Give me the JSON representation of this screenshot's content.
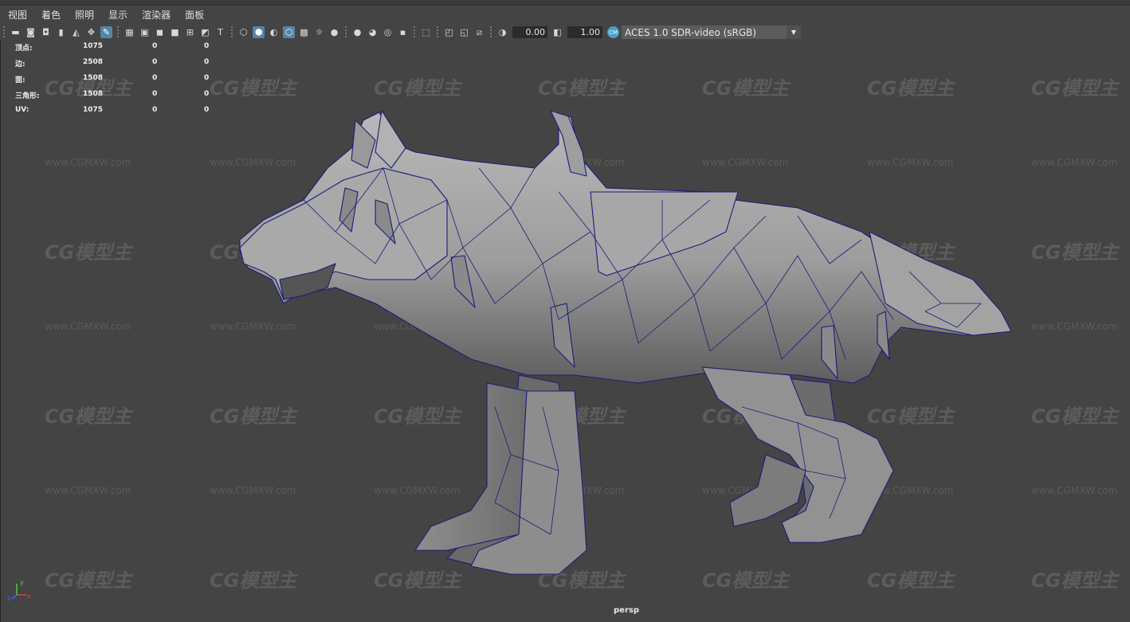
{
  "menu": [
    "视图",
    "着色",
    "照明",
    "显示",
    "渲染器",
    "面板"
  ],
  "toolbar": {
    "exposure_value": "0.00",
    "gamma_value": "1.00",
    "color_mgmt_badge": "CM",
    "color_space": "ACES 1.0 SDR-video (sRGB)"
  },
  "hud": {
    "rows": [
      {
        "label": "顶点:",
        "v1": "1075",
        "v2": "0",
        "v3": "0"
      },
      {
        "label": "边:",
        "v1": "2508",
        "v2": "0",
        "v3": "0"
      },
      {
        "label": "面:",
        "v1": "1508",
        "v2": "0",
        "v3": "0"
      },
      {
        "label": "三角形:",
        "v1": "1508",
        "v2": "0",
        "v3": "0"
      },
      {
        "label": "UV:",
        "v1": "1075",
        "v2": "0",
        "v3": "0"
      }
    ]
  },
  "watermark": {
    "logo": "CG模型主",
    "url": "www.CGMXW.com"
  },
  "axis": {
    "x": "x",
    "y": "y",
    "z": "z"
  },
  "camera_label": "persp",
  "icons": [
    "camera-icon",
    "select-camera-icon",
    "camera-attr-icon",
    "bookmark-icon",
    "image-plane-icon",
    "2d-pan-icon",
    "grease-pencil-icon",
    "grid-icon",
    "film-gate-icon",
    "resolution-gate-icon",
    "gate-mask-icon",
    "field-chart-icon",
    "safe-action-icon",
    "safe-title-icon",
    "wireframe-icon",
    "smooth-shade-icon",
    "default-material-icon",
    "wireframe-on-shaded-icon",
    "textured-icon",
    "lights-icon",
    "shadows-icon",
    "screen-space-ao-icon",
    "motion-blur-icon",
    "anti-aliasing-icon",
    "depth-of-field-icon",
    "isolate-select-icon",
    "xray-icon",
    "xray-active-icon",
    "xray-joints-icon",
    "backface-icon",
    "exposure-icon",
    "gamma-icon",
    "color-mgmt-icon"
  ]
}
